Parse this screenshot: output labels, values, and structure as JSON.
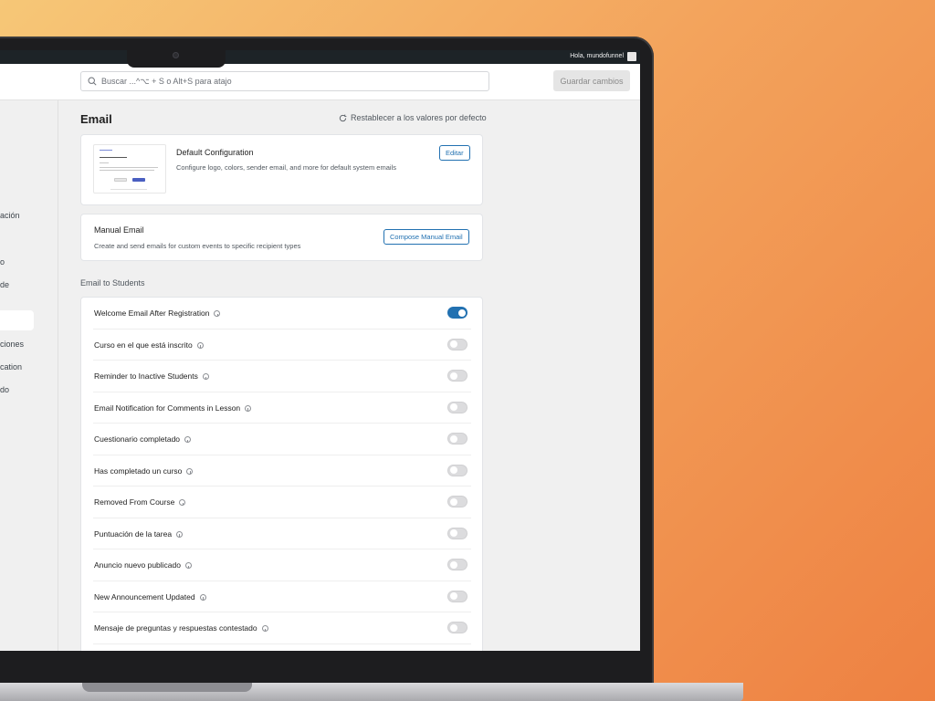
{
  "admin_bar": {
    "greeting": "Hola, mundofunnel"
  },
  "topbar": {
    "search_placeholder": "Buscar ...^⌥ + S o Alt+S para atajo",
    "save_label": "Guardar cambios"
  },
  "sidebar": {
    "items": [
      {
        "label": "ación"
      },
      {
        "label": "o"
      },
      {
        "label": "de"
      },
      {
        "label": "ciones"
      },
      {
        "label": "cation"
      },
      {
        "label": "do"
      }
    ]
  },
  "page": {
    "title": "Email",
    "reset_label": "Restablecer a los valores por defecto"
  },
  "default_config": {
    "title": "Default Configuration",
    "description": "Configure logo, colors, sender email, and more for default system emails",
    "edit_label": "Editar"
  },
  "manual_email": {
    "title": "Manual Email",
    "description": "Create and send emails for custom events to specific recipient types",
    "compose_label": "Compose Manual Email"
  },
  "students_section": {
    "label": "Email to Students",
    "items": [
      {
        "label": "Welcome Email After Registration",
        "enabled": true
      },
      {
        "label": "Curso en el que está inscrito",
        "enabled": false
      },
      {
        "label": "Reminder to Inactive Students",
        "enabled": false
      },
      {
        "label": "Email Notification for Comments in Lesson",
        "enabled": false
      },
      {
        "label": "Cuestionario completado",
        "enabled": false
      },
      {
        "label": "Has completado un curso",
        "enabled": false
      },
      {
        "label": "Removed From Course",
        "enabled": false
      },
      {
        "label": "Puntuación de la tarea",
        "enabled": false
      },
      {
        "label": "Anuncio nuevo publicado",
        "enabled": false
      },
      {
        "label": "New Announcement Updated",
        "enabled": false
      },
      {
        "label": "Mensaje de preguntas y respuestas contestado",
        "enabled": false
      }
    ]
  },
  "colors": {
    "accent": "#2271b1",
    "toggle_off": "#dcdcde",
    "background": "#f0f0f0"
  }
}
